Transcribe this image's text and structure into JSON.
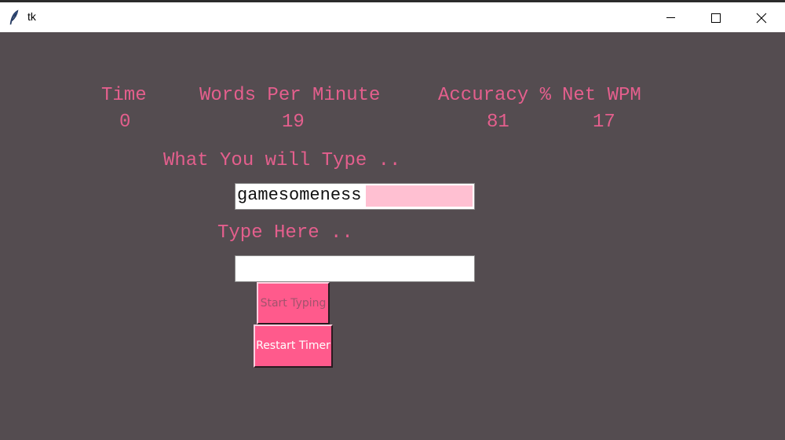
{
  "window": {
    "title": "tk",
    "icon": "feather-icon",
    "controls": [
      "minimize-icon",
      "maximize-icon",
      "close-icon"
    ]
  },
  "stats": {
    "time_label": "Time",
    "time_value": "0",
    "wpm_label": "Words Per Minute",
    "wpm_value": "19",
    "accuracy_label": "Accuracy %",
    "accuracy_value": "81",
    "net_wpm_label": "Net WPM",
    "net_wpm_value": "17"
  },
  "prompt": {
    "label": "What You will Type ..",
    "value": "gamesomeness"
  },
  "typing": {
    "label": "Type Here ..",
    "value": ""
  },
  "buttons": {
    "start_label": "Start Typing",
    "restart_label": "Restart Timer"
  },
  "colors": {
    "background": "#544c50",
    "label_pink": "#e45f8d",
    "button_pink": "#ff5a8c",
    "highlight_pink": "#ffc0d2"
  }
}
